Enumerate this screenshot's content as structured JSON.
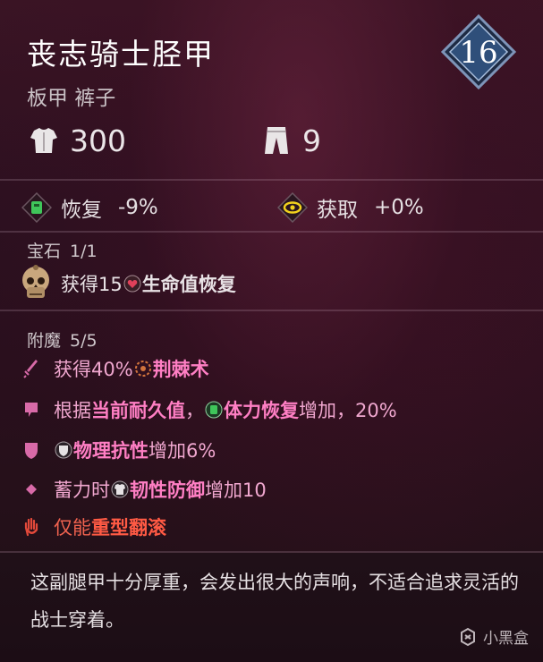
{
  "item": {
    "title": "丧志骑士胫甲",
    "subtitle": "板甲 裤子",
    "level": "16"
  },
  "stats": {
    "armor": {
      "icon": "chest-armor-icon",
      "value": "300"
    },
    "weight": {
      "icon": "pants-weight-icon",
      "value": "9"
    }
  },
  "sub_stats": {
    "recovery": {
      "icon": "green-recovery-icon",
      "label": "恢复",
      "value": "-9%"
    },
    "gain": {
      "icon": "yellow-eye-gain-icon",
      "label": "获取",
      "value": "+0%"
    }
  },
  "gem": {
    "label": "宝石",
    "count": "1/1",
    "icon": "skull-gem-icon",
    "text_pre": "获得15",
    "text_icon": "heart-icon",
    "text_strong": "生命值恢复"
  },
  "enchant": {
    "label": "附魔",
    "count": "5/5",
    "rows": [
      {
        "icon": "dagger-icon",
        "pre": "获得40%",
        "inline_icon": "thorns-icon",
        "hl": "荆棘术",
        "post": ""
      },
      {
        "icon": "flag-icon",
        "pre": "根据",
        "hl": "当前耐久值",
        "mid": "，",
        "inline_icon": "stamina-icon",
        "hl2": "体力恢复",
        "post": "增加，20%"
      },
      {
        "icon": "shield-bullet-icon",
        "pre": "",
        "inline_icon": "shield-small-icon",
        "hl": "物理抗性",
        "post": "增加6%"
      },
      {
        "icon": "diamond-bullet-icon",
        "pre": "蓄力时",
        "inline_icon": "armor-small-icon",
        "hl": "韧性防御",
        "post": "增加10"
      },
      {
        "icon": "hand-print-icon",
        "pre": "仅能",
        "hl": "重型翻滚",
        "post": ""
      }
    ]
  },
  "lore": "这副腿甲十分厚重，会发出很大的声响，不适合追求灵活的战士穿着。",
  "watermark": "小黑盒",
  "colors": {
    "background": "#2a0f1d",
    "enchant_text": "#f0a7cf",
    "enchant_highlight": "#ff7fc4",
    "restriction_red": "#f0624f",
    "badge_blue": "#2f4f7a"
  }
}
